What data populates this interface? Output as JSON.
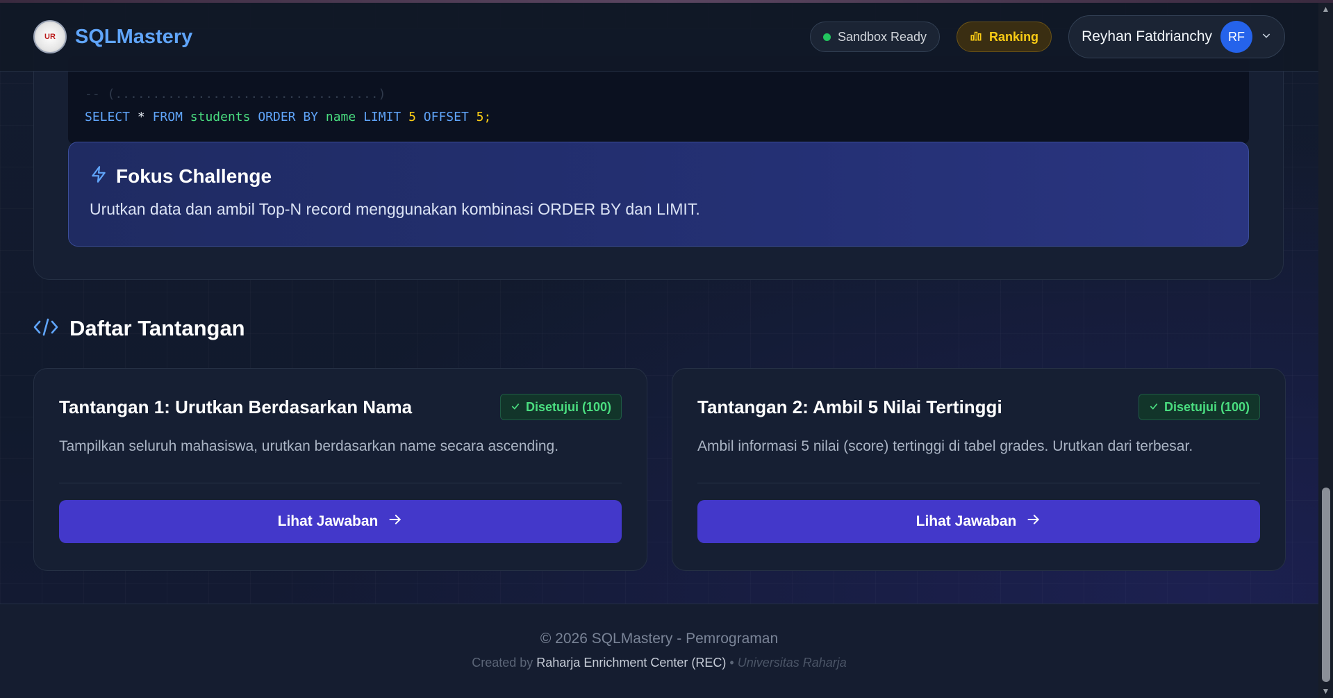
{
  "header": {
    "brand": "SQLMastery",
    "logo_text": "UR",
    "sandbox_status": "Sandbox Ready",
    "ranking_label": "Ranking",
    "user_name": "Reyhan Fatdrianchy",
    "user_initials": "RF"
  },
  "code": {
    "faded_line": "-- (...................................)",
    "tokens": [
      "SELECT",
      "*",
      "FROM",
      "students",
      "ORDER BY",
      "name",
      "LIMIT",
      "5",
      "OFFSET",
      "5;"
    ]
  },
  "focus": {
    "title": "Fokus Challenge",
    "description": "Urutkan data dan ambil Top-N record menggunakan kombinasi ORDER BY dan LIMIT."
  },
  "section": {
    "title": "Daftar Tantangan"
  },
  "challenges": [
    {
      "title": "Tantangan 1: Urutkan Berdasarkan Nama",
      "badge": "Disetujui (100)",
      "description": "Tampilkan seluruh mahasiswa, urutkan berdasarkan name secara ascending.",
      "button": "Lihat Jawaban"
    },
    {
      "title": "Tantangan 2: Ambil 5 Nilai Tertinggi",
      "badge": "Disetujui (100)",
      "description": "Ambil informasi 5 nilai (score) tertinggi di tabel grades. Urutkan dari terbesar.",
      "button": "Lihat Jawaban"
    }
  ],
  "footer": {
    "copyright": "© 2026 SQLMastery - Pemrograman",
    "created_by": "Created by",
    "org": "Raharja Enrichment Center (REC)",
    "separator": "•",
    "university": "Universitas Raharja"
  },
  "colors": {
    "accent": "#60a5fa",
    "button": "#4338ca",
    "success": "#4ade80",
    "ranking": "#facc15"
  }
}
